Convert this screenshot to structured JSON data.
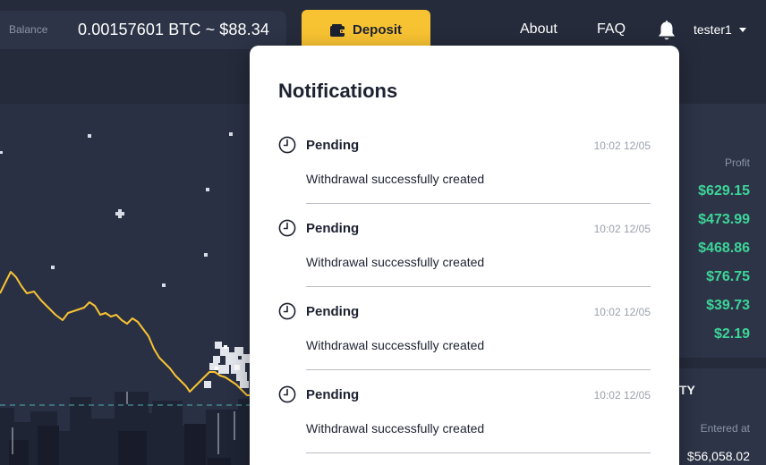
{
  "header": {
    "balance_label": "Balance",
    "balance_value": "0.00157601 BTC ~ $88.34",
    "deposit_label": "Deposit",
    "nav": {
      "about": "About",
      "faq": "FAQ"
    },
    "username": "tester1"
  },
  "notifications": {
    "title": "Notifications",
    "items": [
      {
        "status": "Pending",
        "time": "10:02 12/05",
        "message": "Withdrawal successfully created"
      },
      {
        "status": "Pending",
        "time": "10:02 12/05",
        "message": "Withdrawal successfully created"
      },
      {
        "status": "Pending",
        "time": "10:02 12/05",
        "message": "Withdrawal successfully created"
      },
      {
        "status": "Pending",
        "time": "10:02 12/05",
        "message": "Withdrawal successfully created"
      }
    ]
  },
  "profit_table": {
    "header": "Profit",
    "values": [
      "$629.15",
      "$473.99",
      "$468.86",
      "$76.75",
      "$39.73",
      "$2.19"
    ]
  },
  "entries_table": {
    "title_fragment": "TY",
    "header": "Entered at",
    "first_value": "$56,058.02"
  },
  "colors": {
    "background": "#252b3b",
    "accent": "#f8c332",
    "profit": "#3dd598",
    "chart_line": "#f8c332"
  },
  "icons": [
    "wallet-icon",
    "bell-icon",
    "caret-down-icon",
    "clock-icon"
  ]
}
